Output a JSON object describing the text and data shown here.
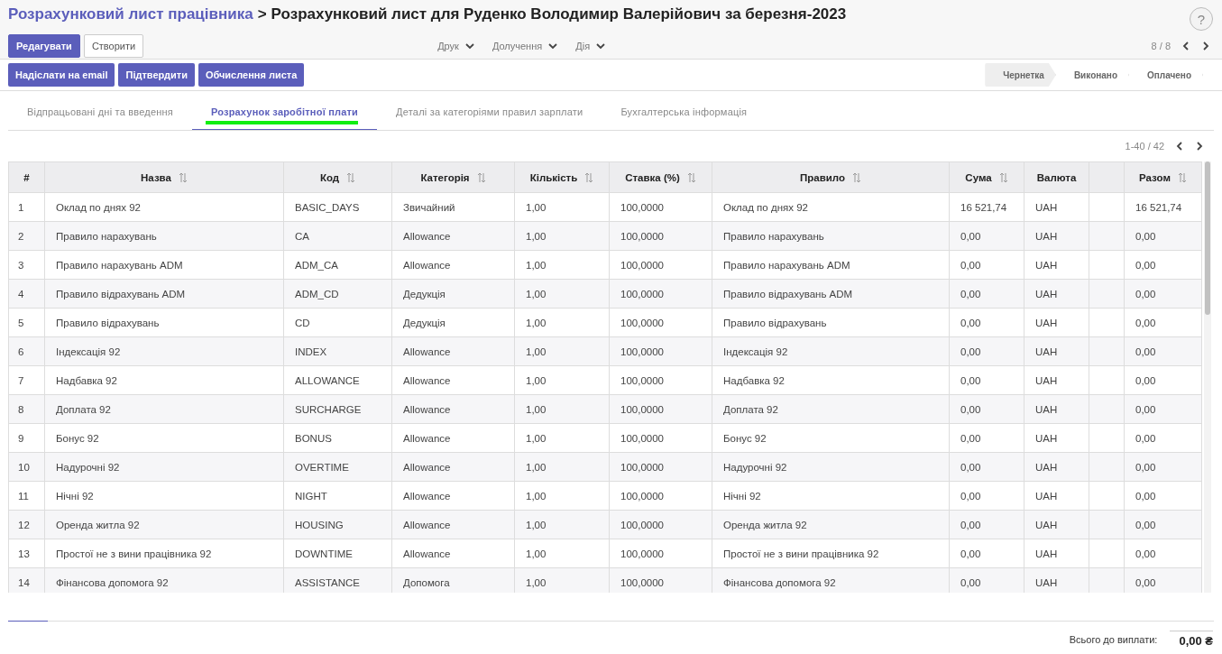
{
  "breadcrumb": {
    "parent": "Розрахунковий лист працівника",
    "separator": ">",
    "current": "Розрахунковий лист для Руденко Володимир Валерійович за березня-2023"
  },
  "help_button": "?",
  "control_panel": {
    "buttons": [
      {
        "label": "Редагувати",
        "kind": "primary"
      },
      {
        "label": "Створити",
        "kind": "secondary"
      }
    ],
    "menus": [
      "Друк",
      "Долучення",
      "Дія"
    ],
    "pager": "8 / 8"
  },
  "actions": [
    "Надіслати на email",
    "Підтвердити",
    "Обчислення листа"
  ],
  "status_steps": [
    {
      "label": "Чернетка",
      "selected": true
    },
    {
      "label": "Виконано",
      "selected": false
    },
    {
      "label": "Оплачено",
      "selected": false
    }
  ],
  "tabs": [
    {
      "label": "Відпрацьовані дні та введення",
      "selected": false
    },
    {
      "label": "Розрахунок заробітної плати",
      "selected": true
    },
    {
      "label": "Деталі за категоріями правил зарплати",
      "selected": false
    },
    {
      "label": "Бухгалтерська інформація",
      "selected": false
    }
  ],
  "table_pager": "1-40 / 42",
  "table": {
    "columns": [
      {
        "label": "#",
        "sortable": false
      },
      {
        "label": "Назва",
        "sortable": true
      },
      {
        "label": "Код",
        "sortable": true
      },
      {
        "label": "Категорія",
        "sortable": true
      },
      {
        "label": "Кількість",
        "sortable": true
      },
      {
        "label": "Ставка (%)",
        "sortable": true
      },
      {
        "label": "Правило",
        "sortable": true
      },
      {
        "label": "Сума",
        "sortable": true
      },
      {
        "label": "Валюта",
        "sortable": false
      },
      {
        "sortable": false
      },
      {
        "label": "Разом",
        "sortable": true
      }
    ],
    "rows": [
      [
        "1",
        "Оклад по днях 92",
        "BASIC_DAYS",
        "Звичайний",
        "1,00",
        "100,0000",
        "Оклад по днях 92",
        "16 521,74",
        "UAH",
        "",
        "16 521,74"
      ],
      [
        "2",
        "Правило нарахувань",
        "CA",
        "Allowance",
        "1,00",
        "100,0000",
        "Правило нарахувань",
        "0,00",
        "UAH",
        "",
        "0,00"
      ],
      [
        "3",
        "Правило нарахувань ADM",
        "ADM_CA",
        "Allowance",
        "1,00",
        "100,0000",
        "Правило нарахувань ADM",
        "0,00",
        "UAH",
        "",
        "0,00"
      ],
      [
        "4",
        "Правило відрахувань ADM",
        "ADM_CD",
        "Дедукція",
        "1,00",
        "100,0000",
        "Правило відрахувань ADM",
        "0,00",
        "UAH",
        "",
        "0,00"
      ],
      [
        "5",
        "Правило відрахувань",
        "CD",
        "Дедукція",
        "1,00",
        "100,0000",
        "Правило відрахувань",
        "0,00",
        "UAH",
        "",
        "0,00"
      ],
      [
        "6",
        "Індексація 92",
        "INDEX",
        "Allowance",
        "1,00",
        "100,0000",
        "Індексація 92",
        "0,00",
        "UAH",
        "",
        "0,00"
      ],
      [
        "7",
        "Надбавка 92",
        "ALLOWANCE",
        "Allowance",
        "1,00",
        "100,0000",
        "Надбавка 92",
        "0,00",
        "UAH",
        "",
        "0,00"
      ],
      [
        "8",
        "Доплата 92",
        "SURCHARGE",
        "Allowance",
        "1,00",
        "100,0000",
        "Доплата 92",
        "0,00",
        "UAH",
        "",
        "0,00"
      ],
      [
        "9",
        "Бонус 92",
        "BONUS",
        "Allowance",
        "1,00",
        "100,0000",
        "Бонус 92",
        "0,00",
        "UAH",
        "",
        "0,00"
      ],
      [
        "10",
        "Надурочні 92",
        "OVERTIME",
        "Allowance",
        "1,00",
        "100,0000",
        "Надурочні 92",
        "0,00",
        "UAH",
        "",
        "0,00"
      ],
      [
        "11",
        "Нічні 92",
        "NIGHT",
        "Allowance",
        "1,00",
        "100,0000",
        "Нічні 92",
        "0,00",
        "UAH",
        "",
        "0,00"
      ],
      [
        "12",
        "Оренда житла 92",
        "HOUSING",
        "Allowance",
        "1,00",
        "100,0000",
        "Оренда житла 92",
        "0,00",
        "UAH",
        "",
        "0,00"
      ],
      [
        "13",
        "Простої не з вини працівника 92",
        "DOWNTIME",
        "Allowance",
        "1,00",
        "100,0000",
        "Простої не з вини працівника 92",
        "0,00",
        "UAH",
        "",
        "0,00"
      ],
      [
        "14",
        "Фінансова допомога 92",
        "ASSISTANCE",
        "Допомога",
        "1,00",
        "100,0000",
        "Фінансова допомога 92",
        "0,00",
        "UAH",
        "",
        "0,00"
      ]
    ]
  },
  "total": {
    "label": "Всього до виплати:",
    "value": "0,00 ₴"
  }
}
